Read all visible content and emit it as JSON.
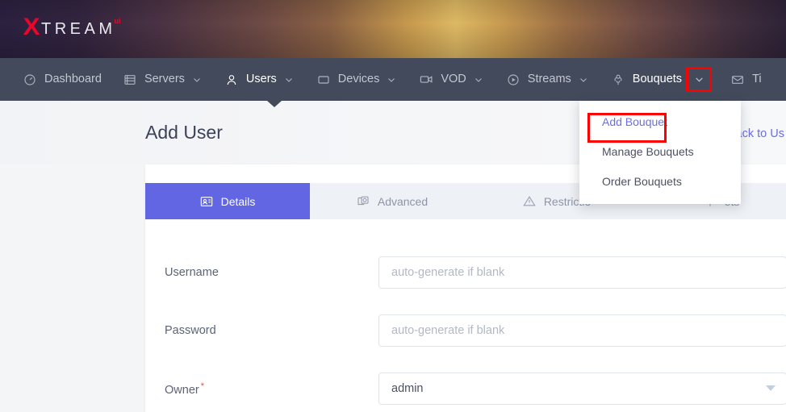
{
  "brand": {
    "logo_x": "X",
    "logo_text": "TREAM",
    "logo_superscript": "ui",
    "accent_red": "#e8072a"
  },
  "nav": {
    "items": [
      {
        "label": "Dashboard",
        "icon": "gauge-icon",
        "has_chevron": false,
        "active": false
      },
      {
        "label": "Servers",
        "icon": "server-icon",
        "has_chevron": true,
        "active": false
      },
      {
        "label": "Users",
        "icon": "user-icon",
        "has_chevron": true,
        "active": true
      },
      {
        "label": "Devices",
        "icon": "device-icon",
        "has_chevron": true,
        "active": false
      },
      {
        "label": "VOD",
        "icon": "video-icon",
        "has_chevron": true,
        "active": false
      },
      {
        "label": "Streams",
        "icon": "play-circle-icon",
        "has_chevron": true,
        "active": false
      },
      {
        "label": "Bouquets",
        "icon": "flower-icon",
        "has_chevron": true,
        "active": true
      },
      {
        "label": "Ti",
        "icon": "envelope-icon",
        "has_chevron": false,
        "active": false
      }
    ],
    "highlight_color": "#ff0000",
    "bar_color": "#434a5b"
  },
  "dropdown": {
    "open_for": "Bouquets",
    "items": [
      {
        "label": "Add Bouquet",
        "selected": true
      },
      {
        "label": "Manage Bouquets",
        "selected": false
      },
      {
        "label": "Order Bouquets",
        "selected": false
      }
    ]
  },
  "page": {
    "title": "Add User",
    "back_link": "Back to Us"
  },
  "card": {
    "tabs": [
      {
        "label": "Details",
        "icon": "id-card-icon",
        "active": true
      },
      {
        "label": "Advanced",
        "icon": "sliders-icon",
        "active": false
      },
      {
        "label": "Restrictio",
        "icon": "warning-triangle-icon",
        "active": false
      },
      {
        "label": "ets",
        "icon": "bouquet-icon",
        "active": false
      }
    ],
    "active_tab_color": "#6366e3",
    "fields": [
      {
        "label": "Username",
        "required": false,
        "type": "text",
        "value": "",
        "placeholder": "auto-generate if blank"
      },
      {
        "label": "Password",
        "required": false,
        "type": "text",
        "value": "",
        "placeholder": "auto-generate if blank"
      },
      {
        "label": "Owner",
        "required": true,
        "type": "select",
        "value": "admin",
        "placeholder": ""
      }
    ]
  }
}
